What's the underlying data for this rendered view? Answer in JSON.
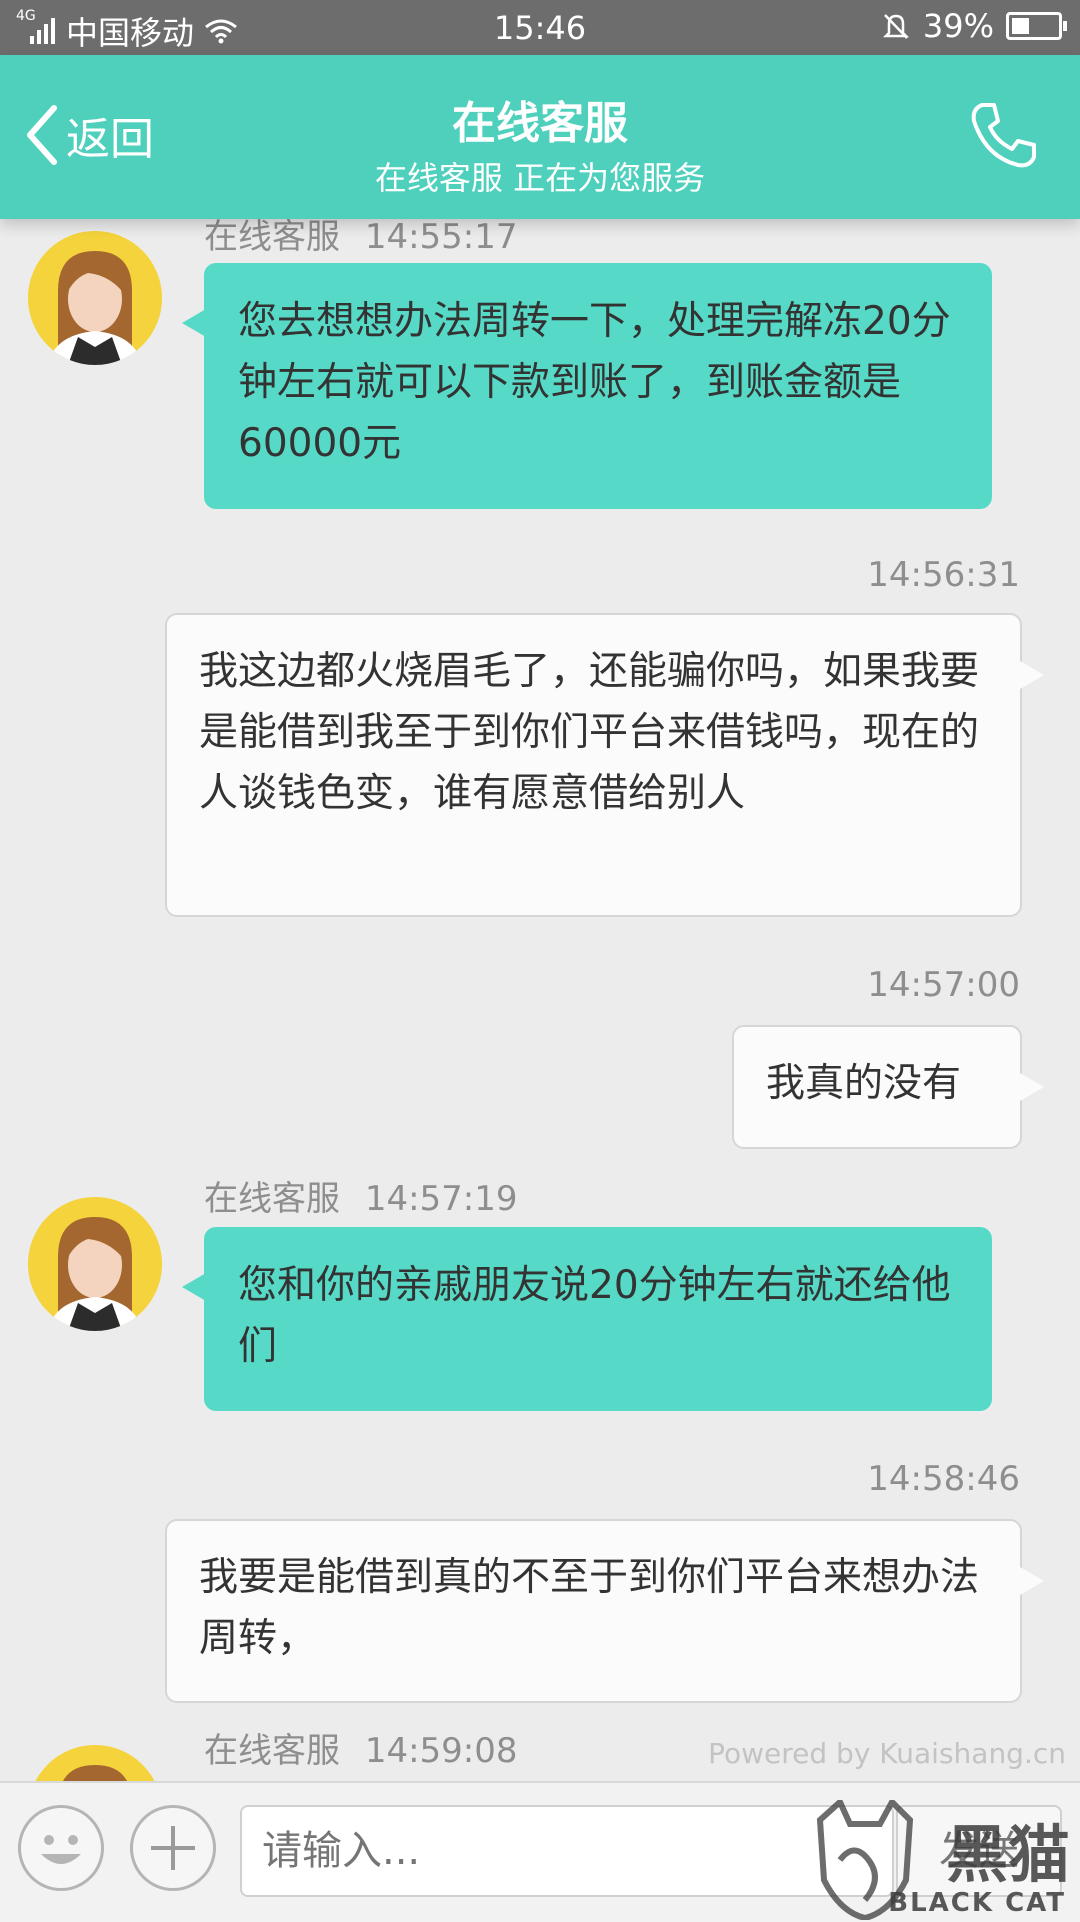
{
  "status_bar": {
    "network": "4G",
    "carrier": "中国移动",
    "time": "15:46",
    "battery": "39%",
    "battery_level": 0.39
  },
  "header": {
    "back_label": "返回",
    "title": "在线客服",
    "subtitle": "在线客服 正在为您服务"
  },
  "messages": [
    {
      "side": "agent",
      "sender": "在线客服",
      "time": "14:55:17",
      "text": "您去想想办法周转一下，处理完解冻20分钟左右就可以下款到账了，到账金额是60000元"
    },
    {
      "side": "user",
      "time": "14:56:31",
      "text": "我这边都火烧眉毛了，还能骗你吗，如果我要是能借到我至于到你们平台来借钱吗，现在的人谈钱色变，谁有愿意借给别人"
    },
    {
      "side": "user",
      "time": "14:57:00",
      "text": "我真的没有"
    },
    {
      "side": "agent",
      "sender": "在线客服",
      "time": "14:57:19",
      "text": "您和你的亲戚朋友说20分钟左右就还给他们"
    },
    {
      "side": "user",
      "time": "14:58:46",
      "text": "我要是能借到真的不至于到你们平台来想办法周转，"
    },
    {
      "side": "agent",
      "sender": "在线客服",
      "time": "14:59:08",
      "text": ""
    }
  ],
  "powered_by": "Powered by Kuaishang.cn",
  "input_bar": {
    "placeholder": "请输入...",
    "send_label": "发送"
  },
  "watermark": {
    "text": "黑猫",
    "subtext": "BLACK CAT"
  },
  "colors": {
    "accent": "#4fd0bd",
    "agent_bubble": "#56d9c6",
    "status_bar": "#6d6d6d"
  }
}
